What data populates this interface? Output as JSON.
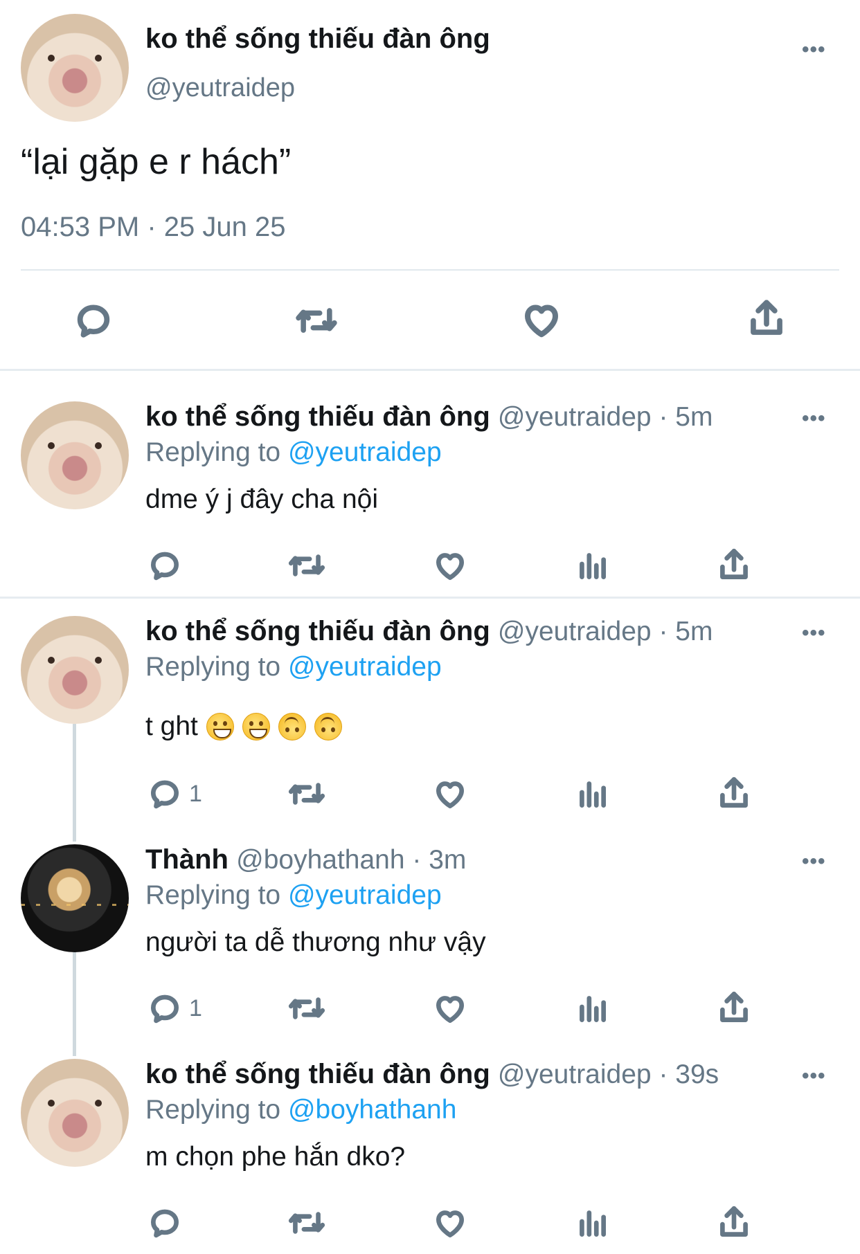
{
  "main_tweet": {
    "author_name": "ko thể sống thiếu đàn ông",
    "author_handle": "@yeutraidep",
    "text": "“lại gặp e r hách”",
    "timestamp": "04:53 PM · 25 Jun 25",
    "more_label": "•••"
  },
  "replies": [
    {
      "name": "ko thể sống thiếu đàn ông",
      "meta": "@yeutraidep · 5m",
      "replying_prefix": "Replying to ",
      "replying_to": "@yeutraidep",
      "text": "dme ý j đây cha nội",
      "reply_count": "",
      "more_label": "•••"
    },
    {
      "name": "ko thể sống thiếu đàn ông",
      "meta": "@yeutraidep · 5m",
      "replying_prefix": "Replying to ",
      "replying_to": "@yeutraidep",
      "text": "t ght",
      "emojis": [
        "grinning-emoji",
        "grinning-emoji",
        "upside-down-emoji",
        "upside-down-emoji"
      ],
      "reply_count": "1",
      "more_label": "•••"
    },
    {
      "name": "Thành",
      "meta": "@boyhathanh · 3m",
      "replying_prefix": "Replying to ",
      "replying_to": "@yeutraidep",
      "text": "người ta dễ thương như vậy",
      "reply_count": "1",
      "more_label": "•••"
    },
    {
      "name": "ko thể sống thiếu đàn ông",
      "meta": "@yeutraidep · 39s",
      "replying_prefix": "Replying to ",
      "replying_to": "@boyhathanh",
      "text": "m chọn phe hắn dko?",
      "reply_count": "",
      "more_label": "•••"
    }
  ],
  "icons": {
    "reply": "reply-icon",
    "retweet": "retweet-icon",
    "like": "like-icon",
    "analytics": "analytics-icon",
    "share": "share-icon"
  },
  "colors": {
    "link": "#1da1f2",
    "secondary_text": "#657786",
    "primary_text": "#14171a",
    "divider": "#e1e8ed"
  }
}
